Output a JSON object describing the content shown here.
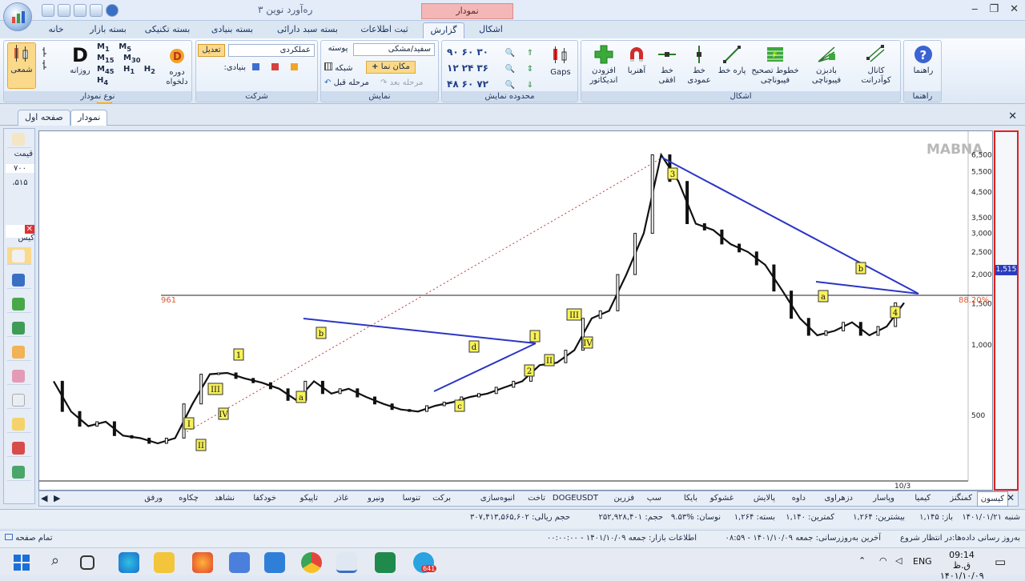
{
  "app": {
    "title": "ره‌آورد نوین ۳",
    "context_tab": "نمودار",
    "window_controls": [
      "‒",
      "❐",
      "✕"
    ]
  },
  "ribbon_tabs": [
    "خانه",
    "بسته بازار",
    "بسته تکنیکی",
    "بسته بنیادی",
    "بسته سبد دارائی",
    "ثبت اطلاعات",
    "گزارش",
    "اشکال"
  ],
  "ribbon": {
    "chart_type": {
      "caption": "نوع نمودار",
      "candle": "شمعی",
      "daily": "روزانه",
      "custom_period": "دوره دلخواه",
      "periods": [
        "W",
        "M",
        "Q",
        "Y"
      ],
      "minutes": [
        "1",
        "5",
        "15",
        "30",
        "45",
        "1",
        "2",
        "4"
      ]
    },
    "company": {
      "caption": "شرکت",
      "performance": "عملکردی",
      "adjust": "تعدیل",
      "fundamental": "بنیادی:"
    },
    "display": {
      "caption": "نمایش",
      "theme_label": "پوسته",
      "theme_value": "سفید/مشکی",
      "grid": "شبکه",
      "cursor": "مکان نما",
      "prev_step": "مرحله قبل",
      "next_step": "مرحله بعد"
    },
    "range": {
      "caption": "محدوده نمایش",
      "values": [
        "۹۰",
        "۶۰",
        "۳۰",
        "۱۲",
        "۲۴",
        "۳۶",
        "۴۸",
        "۶۰",
        "۷۲"
      ],
      "gaps": "Gaps"
    },
    "shapes": {
      "caption": "اشکال",
      "items": [
        "افزودن اندیکاتور",
        "آهنربا",
        "خط افقی",
        "خط عمودی",
        "پاره خط",
        "خطوط تصحیح فیبوناچی",
        "بادبزن فیبوناچی",
        "کانال کوآدرانت"
      ]
    },
    "help": {
      "caption": "راهنما",
      "label": "راهنما"
    }
  },
  "doc_tabs": {
    "first": "صفحه اول",
    "chart": "نمودار"
  },
  "left_panel": {
    "price_label": "قیمت",
    "price_value": "۷۰۰",
    "price_value2": "،۵۱۵",
    "tab_label": "کیس"
  },
  "chart": {
    "watermark": "MABNA",
    "y_labels": [
      "6,500",
      "5,500",
      "4,500",
      "3,500",
      "3,000",
      "2,500",
      "2,000",
      "1,500",
      "1,000",
      "500"
    ],
    "current_price": "1,515",
    "hline_value": "961",
    "hline_pct": "88.20%",
    "x_label": "10/3",
    "wave_labels": [
      "I",
      "II",
      "III",
      "IV",
      "1",
      "a",
      "b",
      "c",
      "d",
      "2",
      "I",
      "II",
      "III",
      "IV",
      "3",
      "a",
      "b",
      "4"
    ]
  },
  "chart_data": {
    "type": "line",
    "ylim": [
      300,
      7000
    ],
    "y_scale": "log",
    "series": [
      {
        "values": [
          700,
          520,
          450,
          470,
          410,
          400,
          380,
          400,
          560,
          750,
          760,
          720,
          690,
          650,
          580,
          700,
          620,
          650,
          600,
          560,
          530,
          520,
          550,
          570,
          600,
          620,
          660,
          700,
          820,
          840,
          950,
          1300,
          1400,
          2000,
          3000,
          6500,
          5000,
          3300,
          3100,
          2700,
          2500,
          2200,
          1700,
          1300,
          1100,
          1150,
          1250,
          1100,
          1200,
          1515
        ]
      }
    ]
  },
  "symbols": [
    "کیسون",
    "کمنگنز",
    "کیمیا",
    "وپاسار",
    "دزهراوی",
    "داوه",
    "پالایش",
    "غشوکو",
    "بایکا",
    "سپ",
    "فزرین",
    "DOGEUSDT",
    "تاخت",
    "انبوه‌سازی",
    "برکت",
    "تنوسا",
    "ونیرو",
    "غاذر",
    "تاپیکو",
    "خودکفا",
    "نشاهد",
    "چکاوه",
    "ورفق"
  ],
  "status": {
    "date": "شنبه ۱۴۰۱/۰۱/۲۱",
    "open": "باز: ۱,۱۴۵",
    "high": "بیشترین: ۱,۲۶۴",
    "low": "کمترین: ۱,۱۴۰",
    "close": "بسته: ۱,۲۶۴",
    "change": "نوسان: %۹.۵۳",
    "volume": "حجم: ۲۵۲,۹۲۸,۴۰۱",
    "value": "حجم ریالی: ۳۰۷,۴۱۳,۵۶۵,۶۰۲"
  },
  "status2": {
    "update": "به‌روز رسانی داده‌ها:در انتظار شروع",
    "last_update": "آخرین به‌روزرسانی: جمعه ۱۴۰۱/۱۰/۰۹ - ۰۸:۵۹",
    "market": "اطلاعات بازار: جمعه ۱۴۰۱/۱۰/۰۹ - ۰۰:۰۰:۰۰",
    "full_page": "تمام صفحه"
  },
  "taskbar": {
    "time": "09:14 ق.ظ",
    "date": "۱۴۰۱/۱۰/۰۹",
    "lang": "ENG",
    "telegram_badge": "641"
  }
}
